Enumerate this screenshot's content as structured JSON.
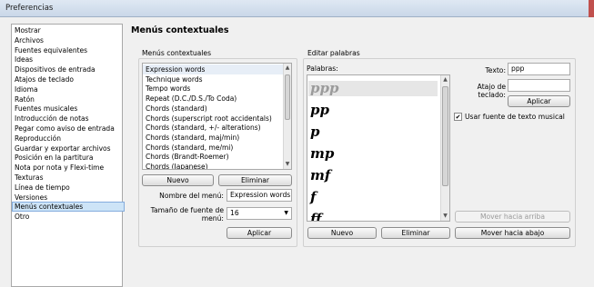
{
  "window": {
    "title": "Preferencias"
  },
  "categories": [
    "Mostrar",
    "Archivos",
    "Fuentes equivalentes",
    "Ideas",
    "Dispositivos de entrada",
    "Atajos de teclado",
    "Idioma",
    "Ratón",
    "Fuentes musicales",
    "Introducción de notas",
    "Pegar como aviso de entrada",
    "Reproducción",
    "Guardar y exportar archivos",
    "Posición en la partitura",
    "Nota por nota y Flexi-time",
    "Texturas",
    "Línea de tiempo",
    "Versiones",
    "Menús contextuales",
    "Otro"
  ],
  "selected_category": "Menús contextuales",
  "page_title": "Menús contextuales",
  "menus": {
    "header": "Menús contextuales",
    "items": [
      "Expression words",
      "Technique words",
      "Tempo words",
      "Repeat (D.C./D.S./To Coda)",
      "Chords (standard)",
      "Chords (superscript root accidentals)",
      "Chords (standard, +/- alterations)",
      "Chords (standard, maj/min)",
      "Chords (standard, me/mi)",
      "Chords (Brandt-Roemer)",
      "Chords (Japanese)"
    ],
    "selected": "Expression words",
    "new_button": "Nuevo",
    "delete_button": "Eliminar",
    "menu_name_label": "Nombre del menú:",
    "menu_name_value": "Expression words",
    "font_size_label": "Tamaño de fuente de menú:",
    "font_size_value": "16",
    "apply_button": "Aplicar"
  },
  "words": {
    "header": "Editar palabras",
    "list_label": "Palabras:",
    "items": [
      "ppp",
      "pp",
      "p",
      "mp",
      "mf",
      "f",
      "ff"
    ],
    "text_label": "Texto:",
    "text_value": "ppp",
    "shortcut_label": "Atajo de teclado:",
    "shortcut_value": "",
    "apply_button": "Aplicar",
    "use_music_font_label": "Usar fuente de texto musical",
    "use_music_font_checked": true,
    "move_up_button": "Mover hacia arriba",
    "move_down_button": "Mover hacia abajo",
    "new_button": "Nuevo",
    "delete_button": "Eliminar"
  }
}
